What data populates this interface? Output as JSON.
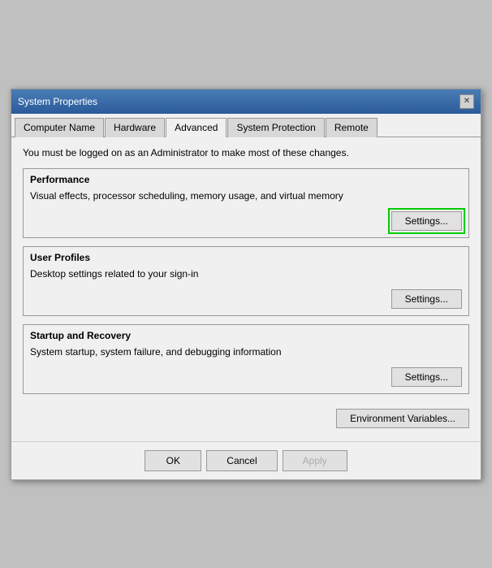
{
  "window": {
    "title": "System Properties",
    "close_btn": "✕"
  },
  "tabs": [
    {
      "label": "Computer Name",
      "active": false
    },
    {
      "label": "Hardware",
      "active": false
    },
    {
      "label": "Advanced",
      "active": true
    },
    {
      "label": "System Protection",
      "active": false
    },
    {
      "label": "Remote",
      "active": false
    }
  ],
  "admin_notice": "You must be logged on as an Administrator to make most of these changes.",
  "sections": [
    {
      "id": "performance",
      "title": "Performance",
      "desc": "Visual effects, processor scheduling, memory usage, and virtual memory",
      "btn_label": "Settings...",
      "highlighted": true
    },
    {
      "id": "user_profiles",
      "title": "User Profiles",
      "desc": "Desktop settings related to your sign-in",
      "btn_label": "Settings...",
      "highlighted": false
    },
    {
      "id": "startup_recovery",
      "title": "Startup and Recovery",
      "desc": "System startup, system failure, and debugging information",
      "btn_label": "Settings...",
      "highlighted": false
    }
  ],
  "env_btn_label": "Environment Variables...",
  "footer": {
    "ok": "OK",
    "cancel": "Cancel",
    "apply": "Apply"
  }
}
